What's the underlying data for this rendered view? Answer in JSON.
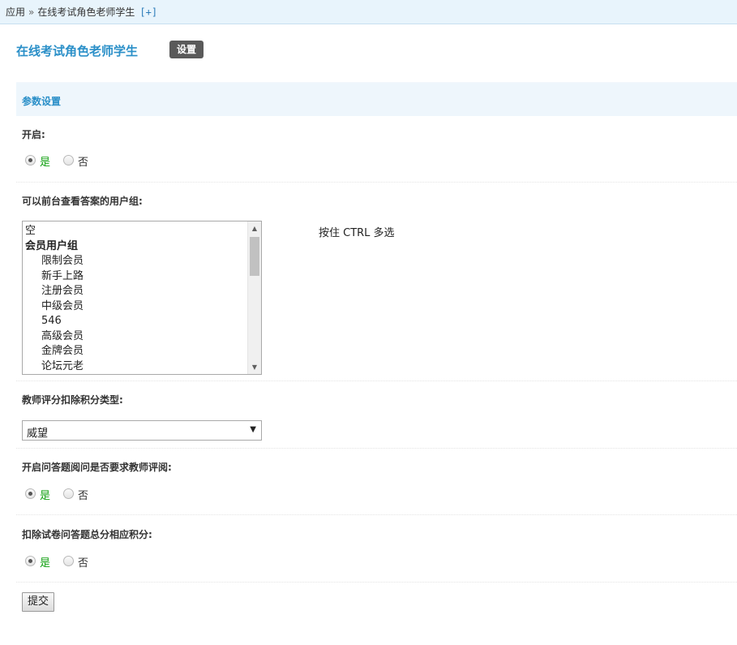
{
  "breadcrumb": {
    "root": "应用",
    "separator": "»",
    "current": "在线考试角色老师学生",
    "add": "[+]"
  },
  "header": {
    "title": "在线考试角色老师学生",
    "badge": "设置"
  },
  "section": {
    "title": "参数设置"
  },
  "fields": {
    "enable": {
      "label": "开启:",
      "yes": "是",
      "no": "否",
      "selected": "是"
    },
    "answer_groups": {
      "label": "可以前台查看答案的用户组:",
      "options": [
        {
          "text": "空",
          "type": "plain"
        },
        {
          "text": "会员用户组",
          "type": "group"
        },
        {
          "text": "限制会员",
          "type": "indent"
        },
        {
          "text": "新手上路",
          "type": "indent"
        },
        {
          "text": "注册会员",
          "type": "indent"
        },
        {
          "text": "中级会员",
          "type": "indent"
        },
        {
          "text": "546",
          "type": "indent"
        },
        {
          "text": "高级会员",
          "type": "indent"
        },
        {
          "text": "金牌会员",
          "type": "indent"
        },
        {
          "text": "论坛元老",
          "type": "indent"
        }
      ],
      "hint": "按住 CTRL 多选"
    },
    "credit_type": {
      "label": "教师评分扣除积分类型:",
      "value": "威望"
    },
    "require_review": {
      "label": "开启问答题阅问是否要求教师评阅:",
      "yes": "是",
      "no": "否",
      "selected": "是"
    },
    "deduct_total": {
      "label": "扣除试卷问答题总分相应积分:",
      "yes": "是",
      "no": "否",
      "selected": "是"
    }
  },
  "submit_label": "提交"
}
